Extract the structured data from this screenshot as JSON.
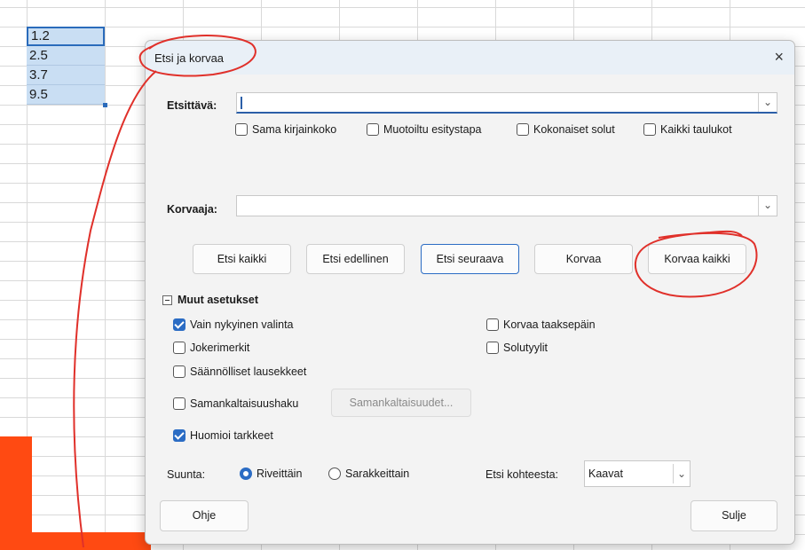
{
  "spreadsheet": {
    "cells": [
      "1.2",
      "2.5",
      "3.7",
      "9.5"
    ]
  },
  "dialog": {
    "title": "Etsi ja korvaa",
    "close_icon": "×",
    "search": {
      "label": "Etsittävä:",
      "value": ""
    },
    "search_options": [
      "Sama kirjainkoko",
      "Muotoiltu esitystapa",
      "Kokonaiset solut",
      "Kaikki taulukot"
    ],
    "replace": {
      "label": "Korvaaja:",
      "value": ""
    },
    "buttons": {
      "find_all": "Etsi kaikki",
      "find_prev": "Etsi edellinen",
      "find_next": "Etsi seuraava",
      "replace": "Korvaa",
      "replace_all": "Korvaa kaikki"
    },
    "more_options": {
      "header": "Muut asetukset",
      "current_selection": "Vain nykyinen valinta",
      "wildcards": "Jokerimerkit",
      "regex": "Säännölliset lausekkeet",
      "similarity": "Samankaltaisuushaku",
      "similarity_button": "Samankaltaisuudet...",
      "diacritics": "Huomioi tarkkeet",
      "backwards": "Korvaa taaksepäin",
      "cell_styles": "Solutyylit"
    },
    "direction": {
      "label": "Suunta:",
      "rows": "Riveittäin",
      "columns": "Sarakkeittain"
    },
    "search_in": {
      "label": "Etsi kohteesta:",
      "value": "Kaavat"
    },
    "help": "Ohje",
    "close": "Sulje"
  },
  "colors": {
    "accent": "#2b6cc4",
    "annotation": "#e0302a",
    "chart_orange": "#ff4a12"
  }
}
